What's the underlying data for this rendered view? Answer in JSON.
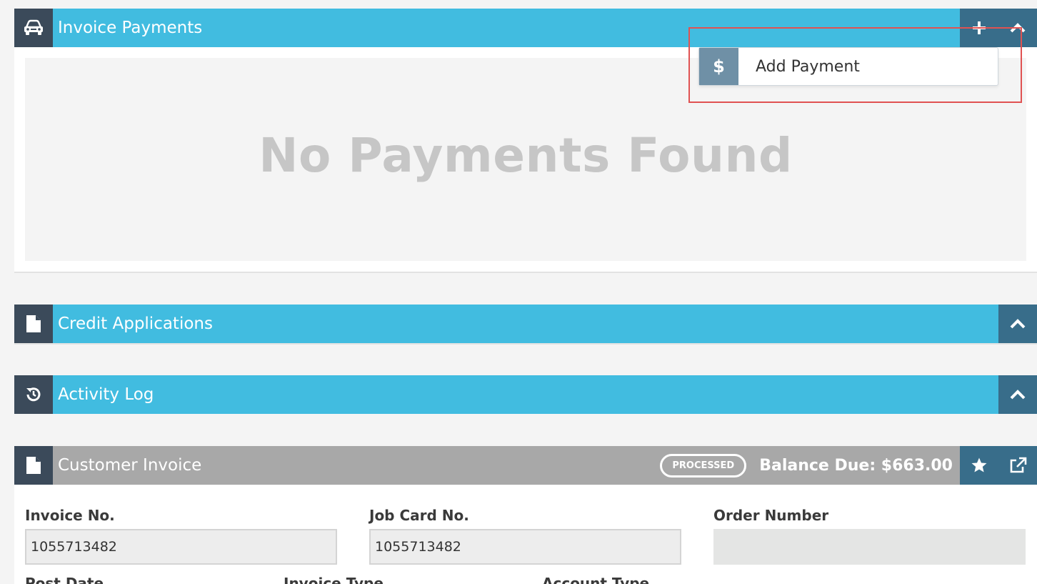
{
  "invoice_payments": {
    "title": "Invoice Payments",
    "icon": "car-icon",
    "add_icon": "plus-icon",
    "collapse_icon": "chevron-up-icon",
    "empty_message": "No Payments Found",
    "dropdown": {
      "item_label": "Add Payment",
      "item_icon": "dollar-icon",
      "item_symbol": "$"
    }
  },
  "credit_applications": {
    "title": "Credit Applications",
    "icon": "document-icon",
    "collapse_icon": "chevron-up-icon"
  },
  "activity_log": {
    "title": "Activity Log",
    "icon": "history-icon",
    "collapse_icon": "chevron-up-icon"
  },
  "customer_invoice": {
    "title": "Customer Invoice",
    "icon": "document-icon",
    "status_badge": "PROCESSED",
    "balance_due": "Balance Due: $663.00",
    "favorite_icon": "star-icon",
    "open_external_icon": "external-link-icon",
    "fields": {
      "invoice_no": {
        "label": "Invoice No.",
        "value": "1055713482"
      },
      "job_card_no": {
        "label": "Job Card No.",
        "value": "1055713482"
      },
      "order_number": {
        "label": "Order Number",
        "value": ""
      },
      "post_date": {
        "label": "Post Date"
      },
      "invoice_type": {
        "label": "Invoice Type"
      },
      "account_type": {
        "label": "Account Type"
      }
    }
  },
  "colors": {
    "header_blue": "#41bce0",
    "header_grey": "#a8a8a8",
    "icon_box": "#3b4a5a",
    "action_button": "#386d8a",
    "highlight_red": "#e05252"
  }
}
